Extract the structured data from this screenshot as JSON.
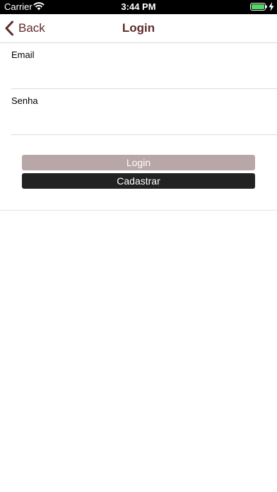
{
  "status_bar": {
    "carrier": "Carrier",
    "time": "3:44 PM",
    "battery_color": "#4cd964"
  },
  "nav": {
    "back_label": "Back",
    "title": "Login",
    "tint_color": "#5e2b2b"
  },
  "form": {
    "email_label": "Email",
    "email_value": "",
    "senha_label": "Senha",
    "senha_value": ""
  },
  "buttons": {
    "login_label": "Login",
    "login_color": "#b9a6a6",
    "cadastrar_label": "Cadastrar",
    "cadastrar_color": "#222222"
  },
  "icons": [
    "wifi-icon",
    "battery-icon",
    "charging-bolt-icon",
    "back-chevron-icon"
  ]
}
